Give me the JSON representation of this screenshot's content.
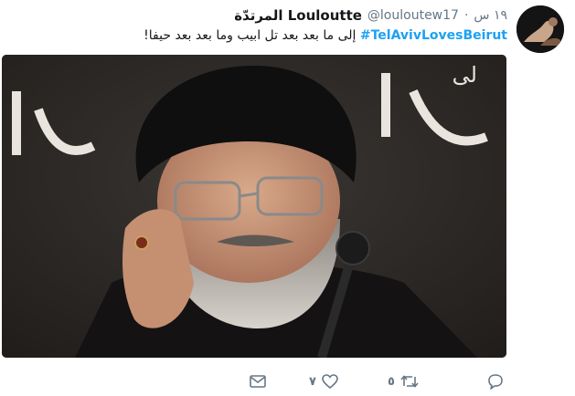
{
  "tweet": {
    "display_name": "Louloutte المرتدّة",
    "handle": "@louloutew17",
    "separator": "·",
    "timestamp": "١٩ س",
    "hashtag": "#TelAvivLovesBeirut",
    "text": "إلى ما بعد بعد تل ابيب وما بعد بعد حيفا!",
    "media": {
      "background_text": "لى"
    }
  },
  "actions": {
    "reply": {
      "icon": "reply-icon",
      "count": ""
    },
    "retweet": {
      "icon": "retweet-icon",
      "count": "٥"
    },
    "like": {
      "icon": "heart-icon",
      "count": "٧"
    },
    "message": {
      "icon": "envelope-icon",
      "count": ""
    }
  },
  "colors": {
    "accent": "#1da1f2",
    "secondary_text": "#657786",
    "primary_text": "#14171a",
    "icon": "#657786"
  }
}
